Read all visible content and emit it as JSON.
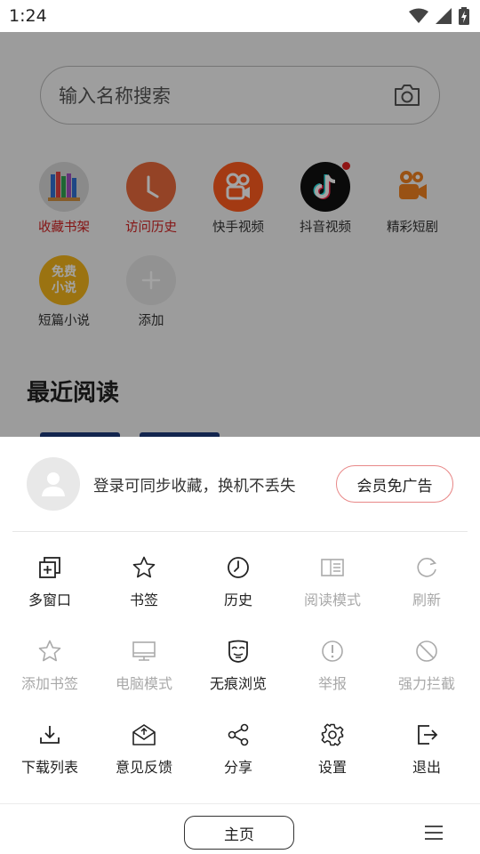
{
  "status_bar": {
    "time": "1:24"
  },
  "search": {
    "placeholder": "输入名称搜索"
  },
  "shortcuts": [
    {
      "label": "收藏书架",
      "icon": "bookshelf-icon"
    },
    {
      "label": "访问历史",
      "icon": "clock-icon"
    },
    {
      "label": "快手视频",
      "icon": "kuaishou-icon"
    },
    {
      "label": "抖音视频",
      "icon": "douyin-icon"
    },
    {
      "label": "精彩短剧",
      "icon": "short-drama-icon"
    },
    {
      "label": "短篇小说",
      "icon": "free-novel-icon",
      "icon_text_1": "免费",
      "icon_text_2": "小说"
    },
    {
      "label": "添加",
      "icon": "plus-icon"
    }
  ],
  "recent": {
    "title": "最近阅读"
  },
  "sheet": {
    "login_text": "登录可同步收藏，换机不丢失",
    "vip_button": "会员免广告",
    "menu": [
      {
        "label": "多窗口",
        "icon": "multi-window-icon",
        "enabled": true
      },
      {
        "label": "书签",
        "icon": "star-icon",
        "enabled": true
      },
      {
        "label": "历史",
        "icon": "history-clock-icon",
        "enabled": true
      },
      {
        "label": "阅读模式",
        "icon": "reading-mode-icon",
        "enabled": false
      },
      {
        "label": "刷新",
        "icon": "refresh-icon",
        "enabled": false
      },
      {
        "label": "添加书签",
        "icon": "add-bookmark-icon",
        "enabled": false
      },
      {
        "label": "电脑模式",
        "icon": "desktop-icon",
        "enabled": false
      },
      {
        "label": "无痕浏览",
        "icon": "incognito-mask-icon",
        "enabled": true
      },
      {
        "label": "举报",
        "icon": "report-icon",
        "enabled": false
      },
      {
        "label": "强力拦截",
        "icon": "block-icon",
        "enabled": false
      },
      {
        "label": "下载列表",
        "icon": "download-icon",
        "enabled": true
      },
      {
        "label": "意见反馈",
        "icon": "feedback-envelope-icon",
        "enabled": true
      },
      {
        "label": "分享",
        "icon": "share-icon",
        "enabled": true
      },
      {
        "label": "设置",
        "icon": "gear-icon",
        "enabled": true
      },
      {
        "label": "退出",
        "icon": "exit-icon",
        "enabled": true
      }
    ]
  },
  "bottom_bar": {
    "home_label": "主页"
  },
  "colors": {
    "accent_red": "#d02020",
    "vip_border": "#e88888",
    "disabled_gray": "#a8a8a8"
  }
}
